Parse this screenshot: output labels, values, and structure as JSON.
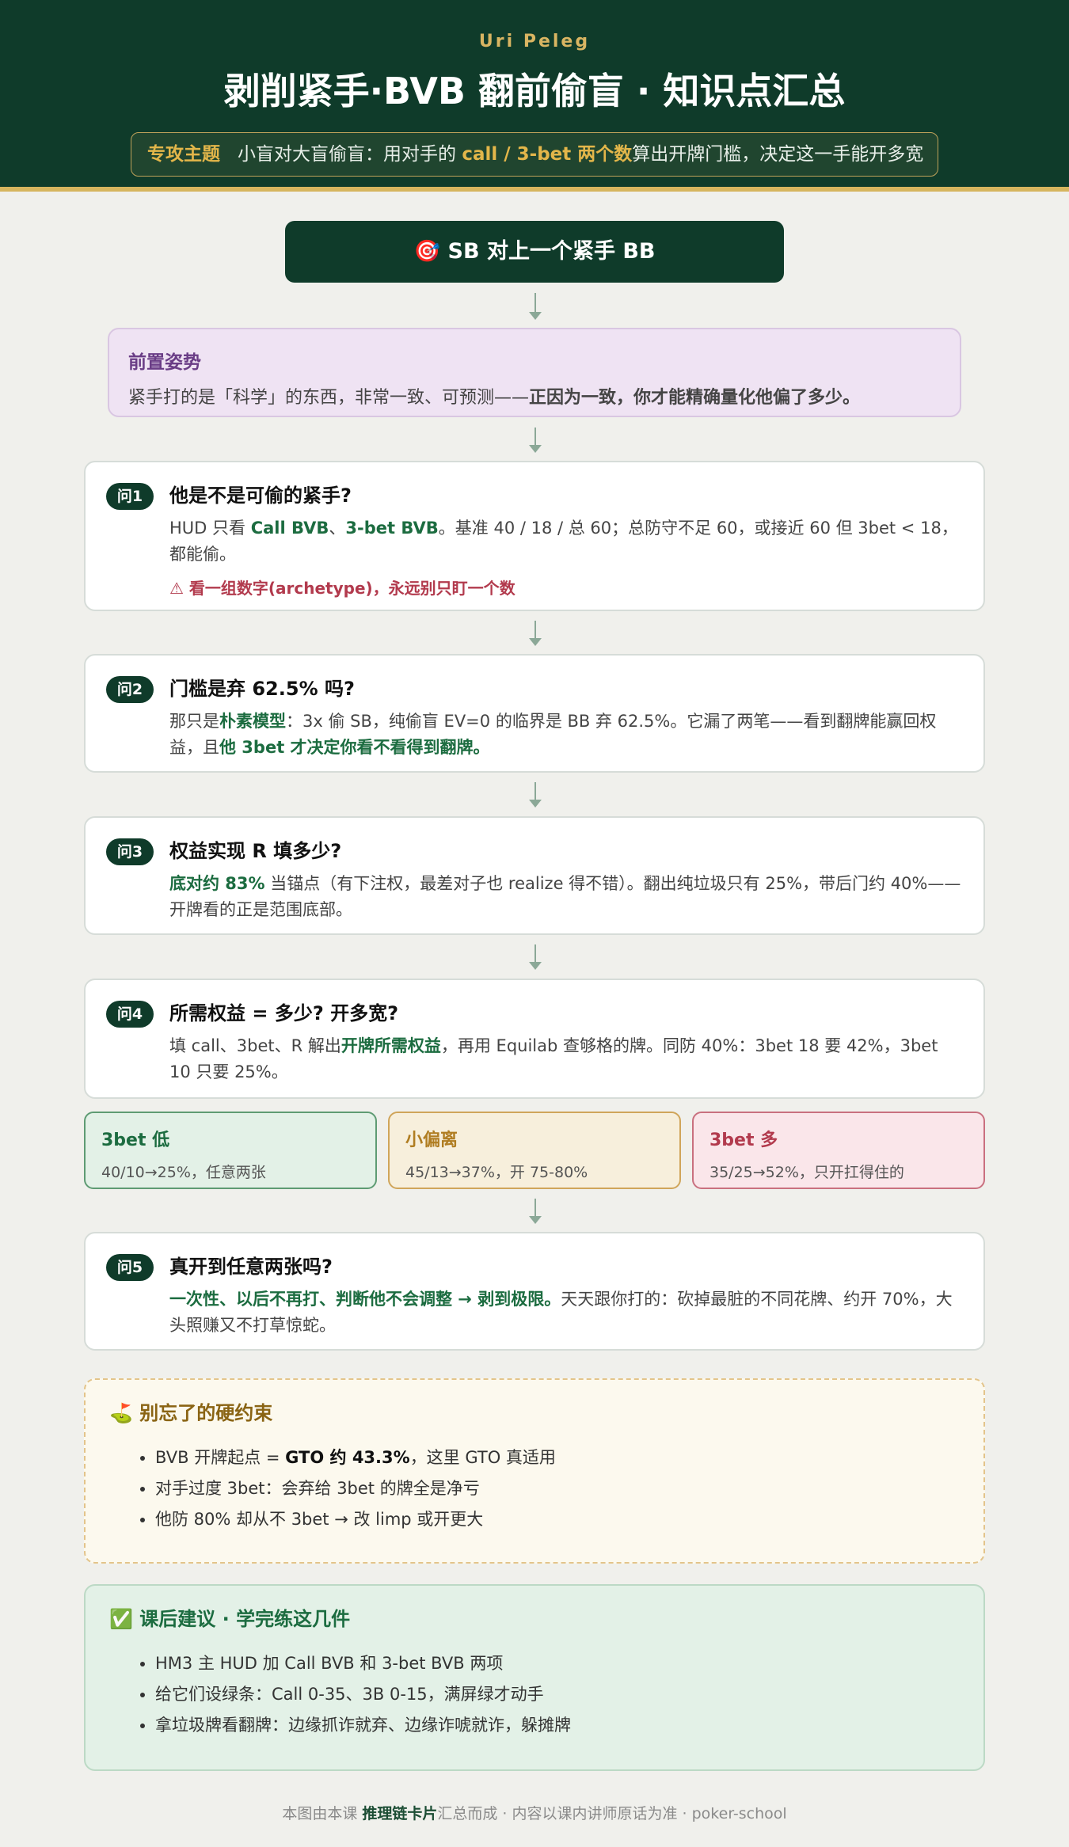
{
  "header": {
    "author": "Uri Peleg",
    "title": "剥削紧手·BVB 翻前偷盲 · 知识点汇总",
    "topic_label": "专攻主题",
    "topic_pre": "小盲对大盲偷盲：用对手的 ",
    "topic_hl": "call / 3-bet 两个数",
    "topic_post": "算出开牌门槛，决定这一手能开多宽"
  },
  "start": {
    "icon": "🎯",
    "label": "SB 对上一个紧手 BB"
  },
  "premise": {
    "heading": "前置姿势",
    "text_pre": "紧手打的是「科学」的东西，非常一致、可预测——",
    "text_bold": "正因为一致，你才能精确量化他偏了多少。"
  },
  "questions": [
    {
      "badge": "问1",
      "title": "他是不是可偷的紧手?",
      "t1": "HUD 只看 ",
      "b1": "Call BVB",
      "t2": "、",
      "b2": "3-bet BVB",
      "t3": "。基准 40 / 18 / 总 60；总防守不足 60，或接近 60 但 3bet < 18，都能偷。",
      "warn": "⚠ 看一组数字(archetype)，永远别只盯一个数"
    },
    {
      "badge": "问2",
      "title": "门槛是弃 62.5% 吗?",
      "t1": "那只是",
      "b1": "朴素模型",
      "t2": "：3x 偷 SB，纯偷盲 EV=0 的临界是 BB 弃 62.5%。它漏了两笔——看到翻牌能赢回权益，且",
      "b2": "他 3bet 才决定你看不看得到翻牌。"
    },
    {
      "badge": "问3",
      "title": "权益实现 R 填多少?",
      "b1": "底对约 83%",
      "t1": " 当锚点（有下注权，最差对子也 realize 得不错）。翻出纯垃圾只有 25%，带后门约 40%——开牌看的正是范围底部。"
    },
    {
      "badge": "问4",
      "title": "所需权益 = 多少?  开多宽?",
      "t1": "填 call、3bet、R 解出",
      "b1": "开牌所需权益",
      "t2": "，再用 Equilab 查够格的牌。同防 40%：3bet 18 要 42%，3bet 10 只要 25%。"
    },
    {
      "badge": "问5",
      "title": "真开到任意两张吗?",
      "b1": "一次性、以后不再打、判断他不会调整 → 剥到极限。",
      "t1": "天天跟你打的：砍掉最脏的不同花牌、约开 70%，大头照赚又不打草惊蛇。"
    }
  ],
  "scenarios": [
    {
      "title": "3bet 低",
      "text": "40/10→25%，任意两张",
      "color": "#1c6c40"
    },
    {
      "title": "小偏离",
      "text": "45/13→37%，开 75-80%",
      "color": "#b07d22"
    },
    {
      "title": "3bet 多",
      "text": "35/25→52%，只开扛得住的",
      "color": "#b23a4d"
    }
  ],
  "constraints": {
    "icon": "⛳",
    "heading": "别忘了的硬约束",
    "items": [
      {
        "pre": "BVB 开牌起点 = ",
        "bold": "GTO 约 43.3%",
        "post": "，这里 GTO 真适用"
      },
      {
        "pre": "对手过度 3bet：会弃给 3bet 的牌全是净亏",
        "bold": "",
        "post": ""
      },
      {
        "pre": "他防 80% 却从不 3bet → 改 limp 或开更大",
        "bold": "",
        "post": ""
      }
    ]
  },
  "homework": {
    "icon": "✅",
    "heading": "课后建议 · 学完练这几件",
    "items": [
      "HM3 主 HUD 加 Call BVB 和 3-bet BVB 两项",
      "给它们设绿条：Call 0-35、3B 0-15，满屏绿才动手",
      "拿垃圾牌看翻牌：边缘抓诈就弃、边缘诈唬就诈，躲摊牌"
    ]
  },
  "footer": {
    "pre": "本图由本课 ",
    "bold": "推理链卡片",
    "post": "汇总而成 · 内容以课内讲师原话为准 · poker-school"
  }
}
